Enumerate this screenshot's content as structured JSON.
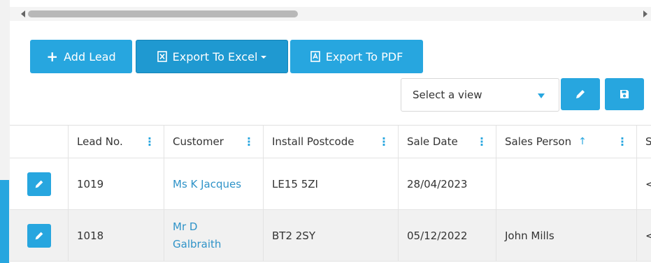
{
  "toolbar": {
    "add_lead": "Add Lead",
    "export_excel": "Export To Excel",
    "export_pdf": "Export To PDF"
  },
  "view_select": {
    "value": "Select a view"
  },
  "columns": [
    "Lead No.",
    "Customer",
    "Install Postcode",
    "Sale Date",
    "Sales Person",
    "S"
  ],
  "rows": [
    {
      "lead_no": "1019",
      "customer": "Ms K Jacques",
      "postcode": "LE15 5ZI",
      "sale_date": "28/04/2023",
      "sales_person": "",
      "next": "<"
    },
    {
      "lead_no": "1018",
      "customer_line1": "Mr D",
      "customer_line2": "Galbraith",
      "postcode": "BT2 2SY",
      "sale_date": "05/12/2022",
      "sales_person": "John Mills",
      "next": "<"
    }
  ],
  "icons": {
    "add": "plus-icon",
    "excel": "excel-file-icon",
    "pdf": "pdf-file-icon",
    "edit": "pencil-icon",
    "save": "floppy-disk-icon",
    "sort": "sort-ascending-icon",
    "column_menu": "kebab-menu-icon"
  },
  "colors": {
    "accent": "#27a6df",
    "link": "#2f93c8",
    "row_alt": "#f1f1f1"
  }
}
